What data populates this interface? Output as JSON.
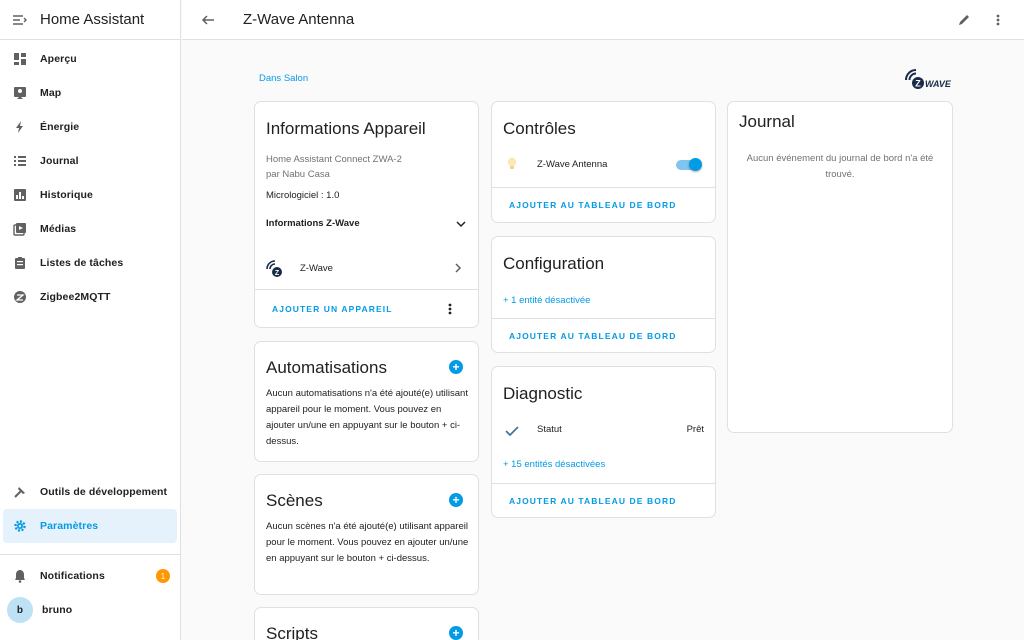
{
  "sidebar": {
    "title": "Home Assistant",
    "items": [
      {
        "label": "Aperçu",
        "icon": "dashboard-icon"
      },
      {
        "label": "Map",
        "icon": "map-icon"
      },
      {
        "label": "Énergie",
        "icon": "lightning-icon"
      },
      {
        "label": "Journal",
        "icon": "list-icon"
      },
      {
        "label": "Historique",
        "icon": "chart-bar-icon"
      },
      {
        "label": "Médias",
        "icon": "media-play-icon"
      },
      {
        "label": "Listes de tâches",
        "icon": "clipboard-list-icon"
      },
      {
        "label": "Zigbee2MQTT",
        "icon": "zigbee-icon"
      }
    ],
    "dev_tools": "Outils de développement",
    "settings": "Paramètres",
    "notifications": "Notifications",
    "notifications_count": "1",
    "user_initial": "b",
    "user_name": "bruno"
  },
  "header": {
    "title": "Z-Wave Antenna"
  },
  "area_link": "Dans Salon",
  "logo_text": "WAVE",
  "logo_letter": "Z",
  "device_info": {
    "title": "Informations Appareil",
    "model": "Home Assistant Connect ZWA-2",
    "manufacturer": "par Nabu Casa",
    "firmware": "Micrologiciel : 1.0",
    "zwave_info": "Informations Z-Wave",
    "integration": "Z-Wave",
    "action": "AJOUTER UN APPAREIL"
  },
  "automations": {
    "title": "Automatisations",
    "text": "Aucun automatisations n'a été ajouté(e) utilisant appareil pour le moment. Vous pouvez en ajouter un/une en appuyant sur le bouton + ci-dessus."
  },
  "scenes": {
    "title": "Scènes",
    "text": "Aucun scènes n'a été ajouté(e) utilisant appareil pour le moment. Vous pouvez en ajouter un/une en appuyant sur le bouton + ci-dessus."
  },
  "scripts": {
    "title": "Scripts"
  },
  "controls": {
    "title": "Contrôles",
    "entity": "Z-Wave Antenna",
    "toggle_on": true,
    "action": "AJOUTER AU TABLEAU DE BORD"
  },
  "configuration": {
    "title": "Configuration",
    "disabled_link": "+ 1 entité désactivée",
    "action": "AJOUTER AU TABLEAU DE BORD"
  },
  "diagnostic": {
    "title": "Diagnostic",
    "status_label": "Statut",
    "status_value": "Prêt",
    "disabled_link": "+ 15 entités désactivées",
    "action": "AJOUTER AU TABLEAU DE BORD"
  },
  "journal": {
    "title": "Journal",
    "empty_text": "Aucun événement du journal de bord n'a été trouvé."
  },
  "colors": {
    "accent": "#039be5",
    "badge": "#ff9800",
    "active_bg": "#e5f1fb"
  }
}
